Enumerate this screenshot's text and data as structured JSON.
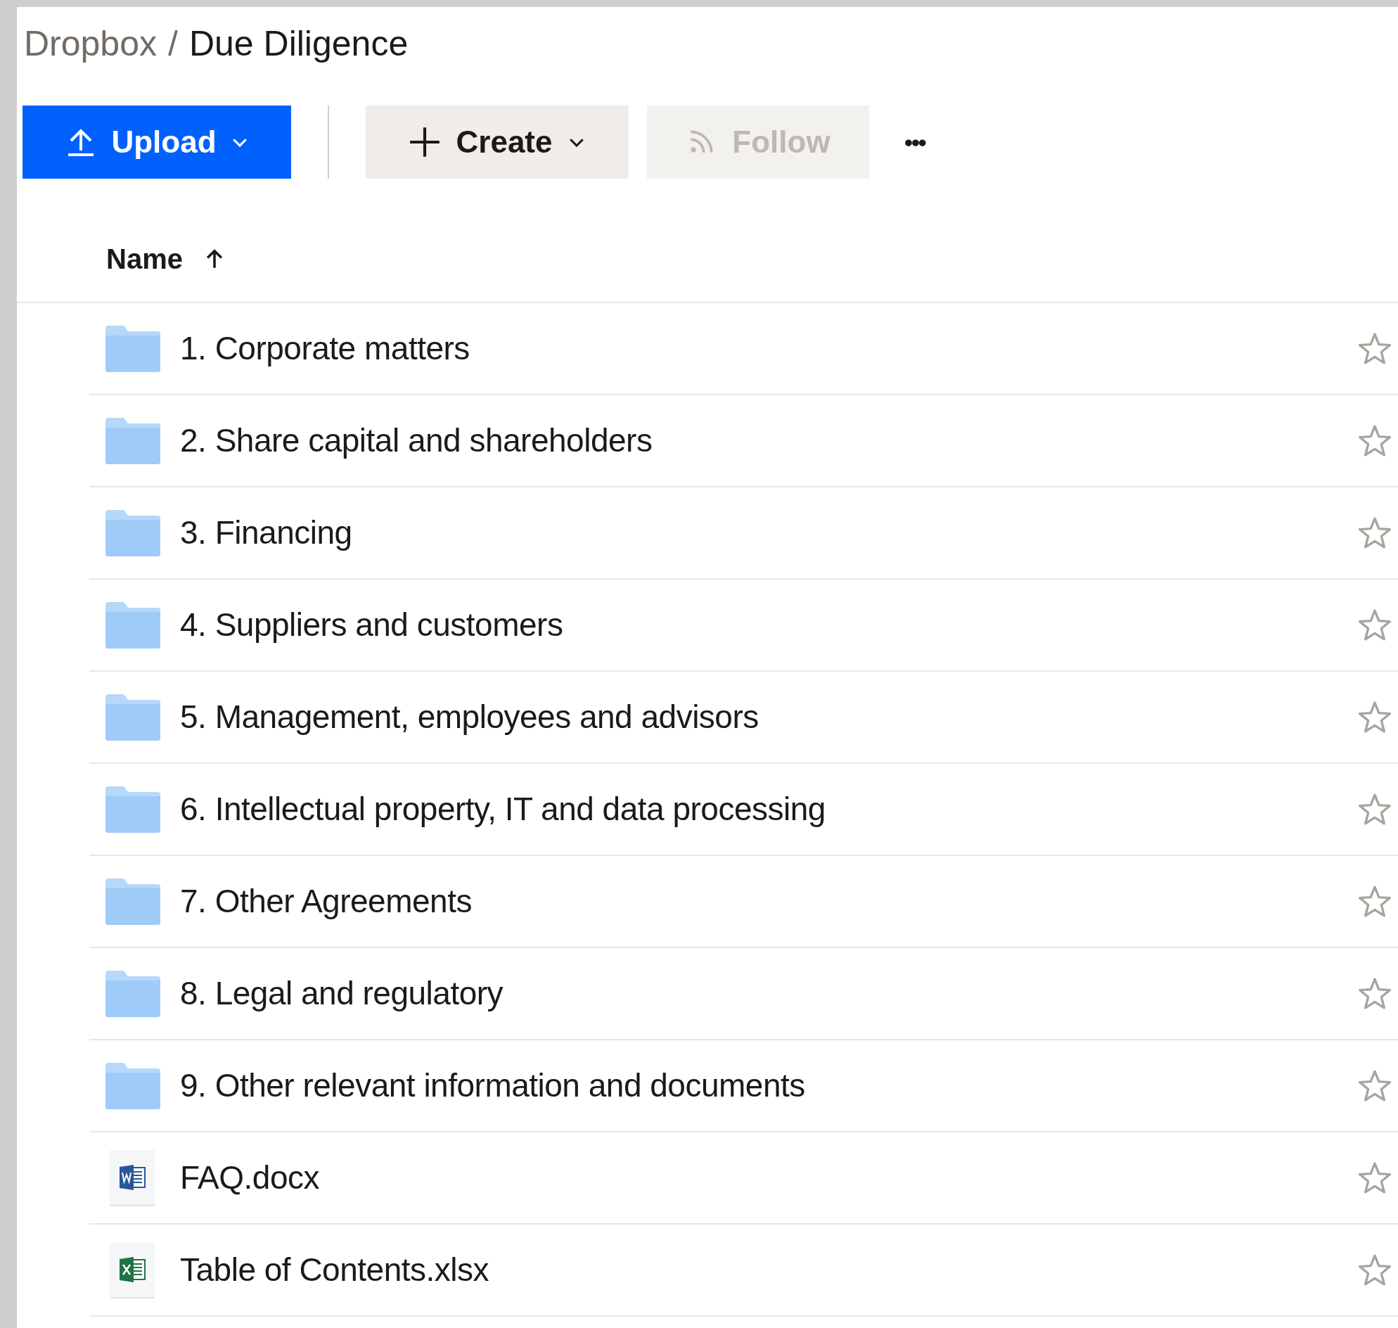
{
  "breadcrumb": {
    "root": "Dropbox",
    "separator": "/",
    "current": "Due Diligence"
  },
  "toolbar": {
    "upload": {
      "label": "Upload"
    },
    "create": {
      "label": "Create"
    },
    "follow": {
      "label": "Follow",
      "disabled": true
    },
    "more": {
      "label": "•••"
    }
  },
  "table": {
    "columns": [
      {
        "label": "Name",
        "sort_ascending": true
      }
    ],
    "rows": [
      {
        "name": "1. Corporate matters",
        "kind": "folder",
        "starred": false
      },
      {
        "name": "2. Share capital and shareholders",
        "kind": "folder",
        "starred": false
      },
      {
        "name": "3. Financing",
        "kind": "folder",
        "starred": false
      },
      {
        "name": "4. Suppliers and customers",
        "kind": "folder",
        "starred": false
      },
      {
        "name": "5. Management, employees and advisors",
        "kind": "folder",
        "starred": false
      },
      {
        "name": "6. Intellectual property, IT and data processing",
        "kind": "folder",
        "starred": false
      },
      {
        "name": "7. Other Agreements",
        "kind": "folder",
        "starred": false
      },
      {
        "name": "8. Legal and regulatory",
        "kind": "folder",
        "starred": false
      },
      {
        "name": "9. Other relevant information and documents",
        "kind": "folder",
        "starred": false
      },
      {
        "name": "FAQ.docx",
        "kind": "word",
        "starred": false
      },
      {
        "name": "Table of Contents.xlsx",
        "kind": "excel",
        "starred": false
      }
    ]
  }
}
